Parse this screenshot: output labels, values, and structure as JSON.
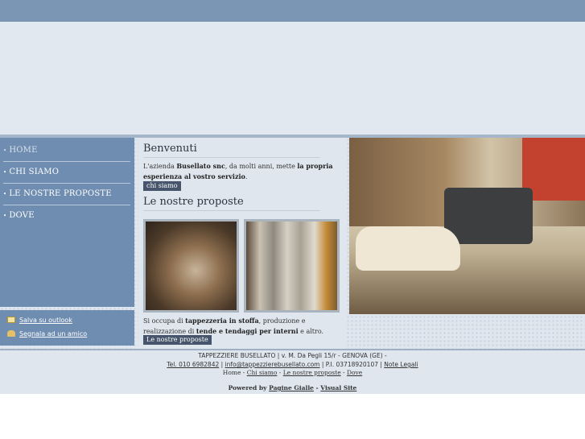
{
  "nav": {
    "items": [
      {
        "label": "HOME"
      },
      {
        "label": "CHI SIAMO"
      },
      {
        "label": "LE NOSTRE PROPOSTE"
      },
      {
        "label": "DOVE"
      }
    ],
    "bullet": "•"
  },
  "tools": {
    "outlook": "Salva su outlook",
    "friend": "Segnala ad un amico"
  },
  "welcome": {
    "title": "Benvenuti",
    "text_pre": "L'azienda ",
    "company": "Busellato snc",
    "text_mid": ", da molti anni, mette ",
    "emph": "la propria esperienza al vostro servizio",
    "text_end": ".",
    "button": "chi siamo"
  },
  "proposals": {
    "title": "Le nostre proposte",
    "text_pre": "Si occupa di ",
    "emph1": "tappezzeria in stoffa",
    "text_mid": ", produzione e realizzazione di ",
    "emph2": "tende e tendaggi per interni",
    "text_end": " e altro.",
    "button": "Le nostre proposte"
  },
  "footer": {
    "address": "TAPPEZZIERE BUSELLATO | v. M. Da Pegli 15/r - GENOVA (GE) -",
    "tel": "Tel. 010 6982842",
    "sep1": " | ",
    "email": "info@tappezzierebusellato.com",
    "piva": " | P.I. 03718920107 | ",
    "legal": "Note Legali",
    "home": "Home",
    "dash": " - ",
    "link_chi": "Chi siamo",
    "link_proposte": "Le nostre proposte",
    "link_dove": "Dove",
    "powered": "Powered by ",
    "pagine": "Pagine Gialle",
    "visual": "Visual Site"
  },
  "colors": {
    "topbar": "#7b96b5",
    "sidebar": "#6f8db0",
    "button": "#46556b"
  },
  "icons": [
    "mail-icon",
    "person-icon"
  ]
}
